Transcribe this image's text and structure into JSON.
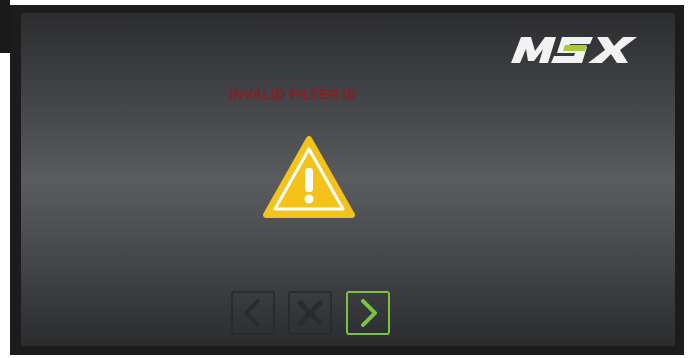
{
  "brand": {
    "logo_text": "MSX",
    "logo_color": "#f2f2f2",
    "logo_accent_color": "#a4cd39"
  },
  "message": {
    "text": "INVALID FILTER ID",
    "color": "#8a1d22"
  },
  "warning": {
    "icon": "warning-triangle-icon",
    "fill_color": "#f3c31c",
    "symbol": "!"
  },
  "navigation": {
    "buttons": [
      {
        "icon": "chevron-left-icon",
        "state": "disabled",
        "color": "#2a2b2d"
      },
      {
        "icon": "close-icon",
        "state": "disabled",
        "color": "#2a2b2d"
      },
      {
        "icon": "chevron-right-icon",
        "state": "active",
        "color": "#7cc242"
      }
    ]
  },
  "colors": {
    "bezel": "#1c1c1c",
    "screen_mid": "#5a5c5f",
    "screen_edge": "#2b2c2e"
  }
}
